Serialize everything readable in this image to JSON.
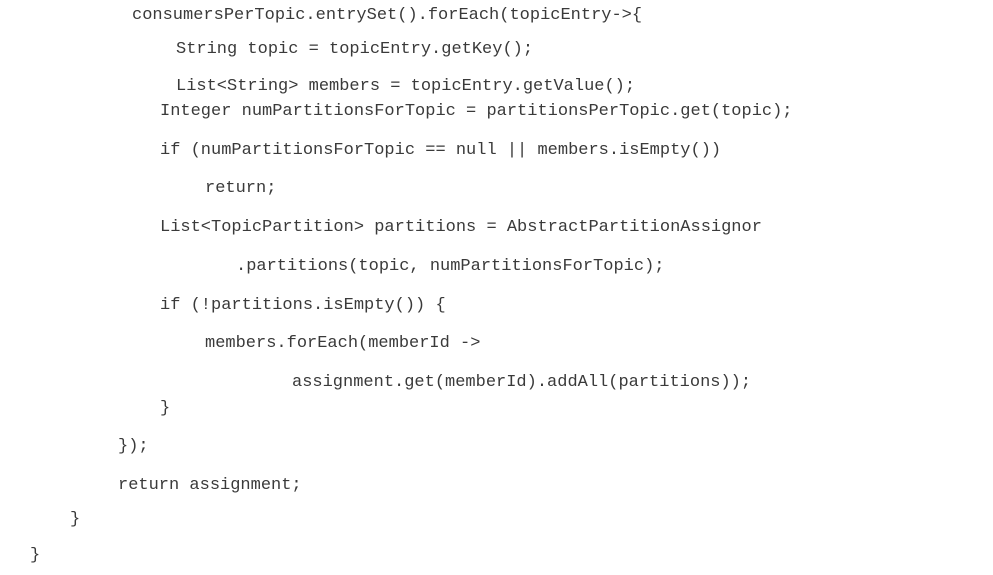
{
  "code": {
    "lines": [
      "consumersPerTopic.entrySet().forEach(topicEntry->{",
      "String topic = topicEntry.getKey();",
      "List<String> members = topicEntry.getValue();",
      "Integer numPartitionsForTopic = partitionsPerTopic.get(topic);",
      "if (numPartitionsForTopic == null || members.isEmpty())",
      "return;",
      "List<TopicPartition> partitions = AbstractPartitionAssignor",
      ".partitions(topic, numPartitionsForTopic);",
      "if (!partitions.isEmpty()) {",
      "members.forEach(memberId ->",
      "assignment.get(memberId).addAll(partitions));",
      "}",
      "});",
      "return assignment;",
      "}",
      "}"
    ]
  }
}
